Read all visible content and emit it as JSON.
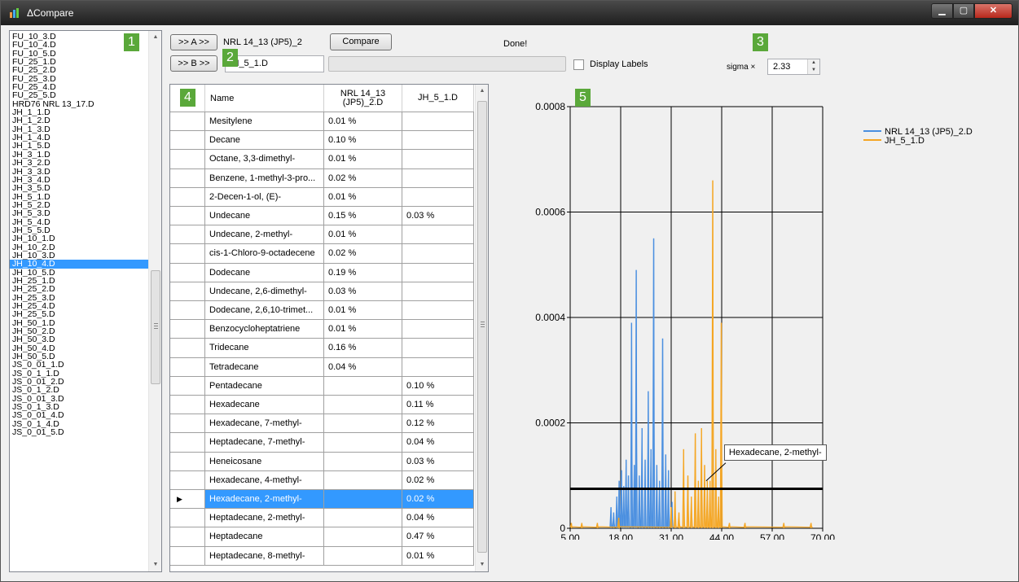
{
  "window": {
    "title": "ΔCompare"
  },
  "file_list": {
    "selected_index": 27,
    "items": [
      "FU_10_3.D",
      "FU_10_4.D",
      "FU_10_5.D",
      "FU_25_1.D",
      "FU_25_2.D",
      "FU_25_3.D",
      "FU_25_4.D",
      "FU_25_5.D",
      "HRD76 NRL 13_17.D",
      "JH_1_1.D",
      "JH_1_2.D",
      "JH_1_3.D",
      "JH_1_4.D",
      "JH_1_5.D",
      "JH_3_1.D",
      "JH_3_2.D",
      "JH_3_3.D",
      "JH_3_4.D",
      "JH_3_5.D",
      "JH_5_1.D",
      "JH_5_2.D",
      "JH_5_3.D",
      "JH_5_4.D",
      "JH_5_5.D",
      "JH_10_1.D",
      "JH_10_2.D",
      "JH_10_3.D",
      "JH_10_4.D",
      "JH_10_5.D",
      "JH_25_1.D",
      "JH_25_2.D",
      "JH_25_3.D",
      "JH_25_4.D",
      "JH_25_5.D",
      "JH_50_1.D",
      "JH_50_2.D",
      "JH_50_3.D",
      "JH_50_4.D",
      "JH_50_5.D",
      "JS_0_01_1.D",
      "JS_0_1_1.D",
      "JS_0_01_2.D",
      "JS_0_1_2.D",
      "JS_0_01_3.D",
      "JS_0_1_3.D",
      "JS_0_01_4.D",
      "JS_0_1_4.D",
      "JS_0_01_5.D"
    ]
  },
  "badges": [
    "1",
    "2",
    "3",
    "4",
    "5"
  ],
  "controls": {
    "a_button": ">> A >>",
    "a_value": "NRL 14_13 (JP5)_2",
    "b_button": ">> B >>",
    "b_value": "JH_5_1.D",
    "compare_button": "Compare",
    "status": "Done!",
    "display_labels": "Display Labels",
    "display_labels_checked": false,
    "sigma_label": "sigma ×",
    "sigma_value": "2.33"
  },
  "grid": {
    "headers": [
      "Name",
      "NRL 14_13 (JP5)_2.D",
      "JH_5_1.D"
    ],
    "selected_row": 20,
    "rows": [
      [
        "Mesitylene",
        "0.01 %",
        ""
      ],
      [
        "Decane",
        "0.10 %",
        ""
      ],
      [
        "Octane, 3,3-dimethyl-",
        "0.01 %",
        ""
      ],
      [
        "Benzene, 1-methyl-3-pro...",
        "0.02 %",
        ""
      ],
      [
        "2-Decen-1-ol, (E)-",
        "0.01 %",
        ""
      ],
      [
        "Undecane",
        "0.15 %",
        "0.03 %"
      ],
      [
        "Undecane, 2-methyl-",
        "0.01 %",
        ""
      ],
      [
        "cis-1-Chloro-9-octadecene",
        "0.02 %",
        ""
      ],
      [
        "Dodecane",
        "0.19 %",
        ""
      ],
      [
        "Undecane, 2,6-dimethyl-",
        "0.03 %",
        ""
      ],
      [
        "Dodecane, 2,6,10-trimet...",
        "0.01 %",
        ""
      ],
      [
        "Benzocycloheptatriene",
        "0.01 %",
        ""
      ],
      [
        "Tridecane",
        "0.16 %",
        ""
      ],
      [
        "Tetradecane",
        "0.04 %",
        ""
      ],
      [
        "Pentadecane",
        "",
        "0.10 %"
      ],
      [
        "Hexadecane",
        "",
        "0.11 %"
      ],
      [
        "Hexadecane, 7-methyl-",
        "",
        "0.12 %"
      ],
      [
        "Heptadecane, 7-methyl-",
        "",
        "0.04 %"
      ],
      [
        "Heneicosane",
        "",
        "0.03 %"
      ],
      [
        "Hexadecane, 4-methyl-",
        "",
        "0.02 %"
      ],
      [
        "Hexadecane, 2-methyl-",
        "",
        "0.02 %"
      ],
      [
        "Heptadecane, 2-methyl-",
        "",
        "0.04 %"
      ],
      [
        "Heptadecane",
        "",
        "0.47 %"
      ],
      [
        "Heptadecane, 8-methyl-",
        "",
        "0.01 %"
      ]
    ]
  },
  "chart_data": {
    "type": "line",
    "x_ticks": [
      "5.00",
      "18.00",
      "31.00",
      "44.00",
      "57.00",
      "70.00"
    ],
    "y_ticks": [
      "0",
      "0.0002",
      "0.0004",
      "0.0006",
      "0.0008"
    ],
    "xlim": [
      5,
      70
    ],
    "ylim": [
      0,
      0.0008
    ],
    "grid": true,
    "legend_position": "top-right",
    "threshold": 7.5e-05,
    "colors": {
      "a": "#4a8fe0",
      "b": "#f5a623",
      "threshold": "#000000"
    },
    "series": [
      {
        "name": "NRL 14_13 (JP5)_2.D",
        "peaks": [
          [
            15.5,
            4e-05
          ],
          [
            16.2,
            3e-05
          ],
          [
            17.0,
            6e-05
          ],
          [
            17.6,
            9e-05
          ],
          [
            18.2,
            0.00011
          ],
          [
            18.8,
            8e-05
          ],
          [
            19.4,
            0.00013
          ],
          [
            20.0,
            0.0001
          ],
          [
            20.8,
            0.00039
          ],
          [
            21.5,
            0.00012
          ],
          [
            22.0,
            0.00049
          ],
          [
            22.8,
            0.0001
          ],
          [
            23.5,
            0.00019
          ],
          [
            24.3,
            0.00013
          ],
          [
            25.1,
            0.00026
          ],
          [
            25.8,
            0.00015
          ],
          [
            26.5,
            0.00055
          ],
          [
            27.3,
            0.00012
          ],
          [
            28.0,
            9e-05
          ],
          [
            28.8,
            0.00036
          ],
          [
            29.6,
            0.00014
          ],
          [
            30.3,
            0.00011
          ],
          [
            31.2,
            5e-05
          ]
        ]
      },
      {
        "name": "JH_5_1.D",
        "peaks": [
          [
            5.3,
            1e-05
          ],
          [
            8.0,
            1e-05
          ],
          [
            12.0,
            1e-05
          ],
          [
            17.5,
            2e-05
          ],
          [
            31.0,
            4e-05
          ],
          [
            32.0,
            7e-05
          ],
          [
            33.0,
            3e-05
          ],
          [
            34.2,
            0.00015
          ],
          [
            35.3,
            0.0001
          ],
          [
            36.2,
            6e-05
          ],
          [
            37.2,
            0.00018
          ],
          [
            38.0,
            9e-05
          ],
          [
            38.8,
            0.00019
          ],
          [
            39.6,
            0.00012
          ],
          [
            40.3,
            9e-05
          ],
          [
            41.0,
            9e-05
          ],
          [
            41.7,
            0.00066
          ],
          [
            42.5,
            0.00015
          ],
          [
            43.2,
            6e-05
          ],
          [
            43.9,
            0.00039
          ],
          [
            46.0,
            1e-05
          ],
          [
            50.0,
            1e-05
          ],
          [
            60.0,
            1e-05
          ],
          [
            67.0,
            1e-05
          ]
        ]
      }
    ],
    "tooltip": {
      "text": "Hexadecane, 2-methyl-",
      "x": 40.0,
      "y": 9e-05
    }
  }
}
